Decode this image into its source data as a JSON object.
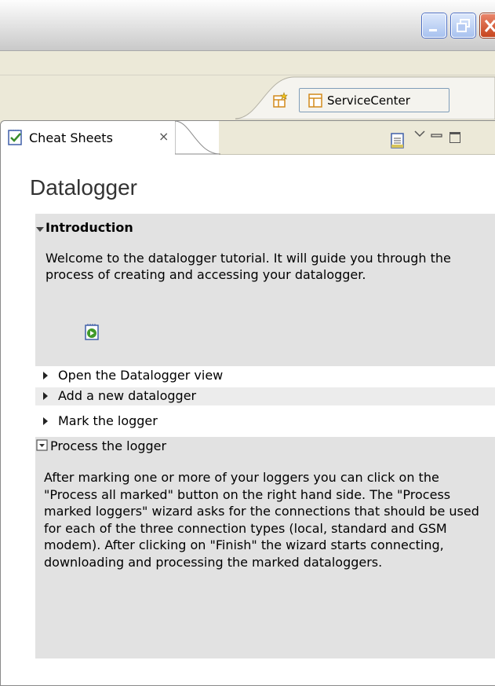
{
  "window": {
    "minimize_icon": "minimize-icon",
    "restore_icon": "restore-icon",
    "close_icon": "close-icon"
  },
  "perspective": {
    "open_perspective_icon": "open-perspective-icon",
    "active_label": "ServiceCenter"
  },
  "view": {
    "tab_label": "Cheat Sheets",
    "tab_close": "×"
  },
  "cheatsheet": {
    "title": "Datalogger",
    "intro": {
      "heading": "Introduction",
      "body": "Welcome to the datalogger tutorial. It will guide you through the process of creating and accessing your datalogger."
    },
    "items": [
      {
        "label": "Open the Datalogger view"
      },
      {
        "label": "Add a new datalogger"
      },
      {
        "label": "Mark the logger"
      }
    ],
    "process": {
      "heading": "Process the logger",
      "body": "After marking one or more of your loggers you can click on the \"Process all marked\" button on the right hand side. The \"Process marked loggers\" wizard asks for the connections that should be used for each of the three connection types (local, standard and GSM modem). After clicking on \"Finish\" the wizard starts connecting, downloading and processing the marked dataloggers."
    }
  },
  "colors": {
    "background": "#ece9d8",
    "item_bg": "#e2e2e2",
    "xp_blue": "#4a6ec6"
  }
}
